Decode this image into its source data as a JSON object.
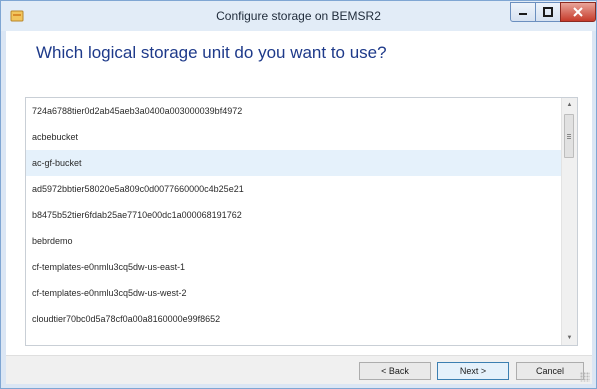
{
  "window": {
    "title": "Configure storage on BEMSR2"
  },
  "page": {
    "heading": "Which logical storage unit do you want to use?"
  },
  "list": {
    "selected_index": 2,
    "items": [
      "724a6788tier0d2ab45aeb3a0400a003000039bf4972",
      "acbebucket",
      "ac-gf-bucket",
      "ad5972bbtier58020e5a809c0d0077660000c4b25e21",
      "b8475b52tier6fdab25ae7710e00dc1a000068191762",
      "bebrdemo",
      "cf-templates-e0nmlu3cq5dw-us-east-1",
      "cf-templates-e0nmlu3cq5dw-us-west-2",
      "cloudtier70bc0d5a78cf0a00a8160000e99f8652"
    ]
  },
  "buttons": {
    "back": "< Back",
    "next": "Next >",
    "cancel": "Cancel"
  },
  "icons": {
    "app": "storage-app-icon",
    "minimize": "minimize-icon",
    "maximize": "maximize-icon",
    "close": "close-icon"
  },
  "colors": {
    "heading": "#1e3a8a",
    "selected_row": "#e5f1fb",
    "close_button": "#c63b2b"
  }
}
